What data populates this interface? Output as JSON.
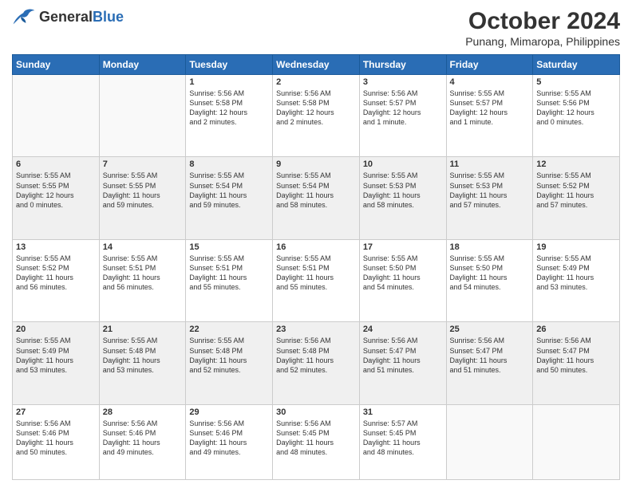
{
  "header": {
    "logo_general": "General",
    "logo_blue": "Blue",
    "month": "October 2024",
    "location": "Punang, Mimaropa, Philippines"
  },
  "weekdays": [
    "Sunday",
    "Monday",
    "Tuesday",
    "Wednesday",
    "Thursday",
    "Friday",
    "Saturday"
  ],
  "weeks": [
    [
      {
        "day": "",
        "info": ""
      },
      {
        "day": "",
        "info": ""
      },
      {
        "day": "1",
        "info": "Sunrise: 5:56 AM\nSunset: 5:58 PM\nDaylight: 12 hours\nand 2 minutes."
      },
      {
        "day": "2",
        "info": "Sunrise: 5:56 AM\nSunset: 5:58 PM\nDaylight: 12 hours\nand 2 minutes."
      },
      {
        "day": "3",
        "info": "Sunrise: 5:56 AM\nSunset: 5:57 PM\nDaylight: 12 hours\nand 1 minute."
      },
      {
        "day": "4",
        "info": "Sunrise: 5:55 AM\nSunset: 5:57 PM\nDaylight: 12 hours\nand 1 minute."
      },
      {
        "day": "5",
        "info": "Sunrise: 5:55 AM\nSunset: 5:56 PM\nDaylight: 12 hours\nand 0 minutes."
      }
    ],
    [
      {
        "day": "6",
        "info": "Sunrise: 5:55 AM\nSunset: 5:55 PM\nDaylight: 12 hours\nand 0 minutes."
      },
      {
        "day": "7",
        "info": "Sunrise: 5:55 AM\nSunset: 5:55 PM\nDaylight: 11 hours\nand 59 minutes."
      },
      {
        "day": "8",
        "info": "Sunrise: 5:55 AM\nSunset: 5:54 PM\nDaylight: 11 hours\nand 59 minutes."
      },
      {
        "day": "9",
        "info": "Sunrise: 5:55 AM\nSunset: 5:54 PM\nDaylight: 11 hours\nand 58 minutes."
      },
      {
        "day": "10",
        "info": "Sunrise: 5:55 AM\nSunset: 5:53 PM\nDaylight: 11 hours\nand 58 minutes."
      },
      {
        "day": "11",
        "info": "Sunrise: 5:55 AM\nSunset: 5:53 PM\nDaylight: 11 hours\nand 57 minutes."
      },
      {
        "day": "12",
        "info": "Sunrise: 5:55 AM\nSunset: 5:52 PM\nDaylight: 11 hours\nand 57 minutes."
      }
    ],
    [
      {
        "day": "13",
        "info": "Sunrise: 5:55 AM\nSunset: 5:52 PM\nDaylight: 11 hours\nand 56 minutes."
      },
      {
        "day": "14",
        "info": "Sunrise: 5:55 AM\nSunset: 5:51 PM\nDaylight: 11 hours\nand 56 minutes."
      },
      {
        "day": "15",
        "info": "Sunrise: 5:55 AM\nSunset: 5:51 PM\nDaylight: 11 hours\nand 55 minutes."
      },
      {
        "day": "16",
        "info": "Sunrise: 5:55 AM\nSunset: 5:51 PM\nDaylight: 11 hours\nand 55 minutes."
      },
      {
        "day": "17",
        "info": "Sunrise: 5:55 AM\nSunset: 5:50 PM\nDaylight: 11 hours\nand 54 minutes."
      },
      {
        "day": "18",
        "info": "Sunrise: 5:55 AM\nSunset: 5:50 PM\nDaylight: 11 hours\nand 54 minutes."
      },
      {
        "day": "19",
        "info": "Sunrise: 5:55 AM\nSunset: 5:49 PM\nDaylight: 11 hours\nand 53 minutes."
      }
    ],
    [
      {
        "day": "20",
        "info": "Sunrise: 5:55 AM\nSunset: 5:49 PM\nDaylight: 11 hours\nand 53 minutes."
      },
      {
        "day": "21",
        "info": "Sunrise: 5:55 AM\nSunset: 5:48 PM\nDaylight: 11 hours\nand 53 minutes."
      },
      {
        "day": "22",
        "info": "Sunrise: 5:55 AM\nSunset: 5:48 PM\nDaylight: 11 hours\nand 52 minutes."
      },
      {
        "day": "23",
        "info": "Sunrise: 5:56 AM\nSunset: 5:48 PM\nDaylight: 11 hours\nand 52 minutes."
      },
      {
        "day": "24",
        "info": "Sunrise: 5:56 AM\nSunset: 5:47 PM\nDaylight: 11 hours\nand 51 minutes."
      },
      {
        "day": "25",
        "info": "Sunrise: 5:56 AM\nSunset: 5:47 PM\nDaylight: 11 hours\nand 51 minutes."
      },
      {
        "day": "26",
        "info": "Sunrise: 5:56 AM\nSunset: 5:47 PM\nDaylight: 11 hours\nand 50 minutes."
      }
    ],
    [
      {
        "day": "27",
        "info": "Sunrise: 5:56 AM\nSunset: 5:46 PM\nDaylight: 11 hours\nand 50 minutes."
      },
      {
        "day": "28",
        "info": "Sunrise: 5:56 AM\nSunset: 5:46 PM\nDaylight: 11 hours\nand 49 minutes."
      },
      {
        "day": "29",
        "info": "Sunrise: 5:56 AM\nSunset: 5:46 PM\nDaylight: 11 hours\nand 49 minutes."
      },
      {
        "day": "30",
        "info": "Sunrise: 5:56 AM\nSunset: 5:45 PM\nDaylight: 11 hours\nand 48 minutes."
      },
      {
        "day": "31",
        "info": "Sunrise: 5:57 AM\nSunset: 5:45 PM\nDaylight: 11 hours\nand 48 minutes."
      },
      {
        "day": "",
        "info": ""
      },
      {
        "day": "",
        "info": ""
      }
    ]
  ]
}
